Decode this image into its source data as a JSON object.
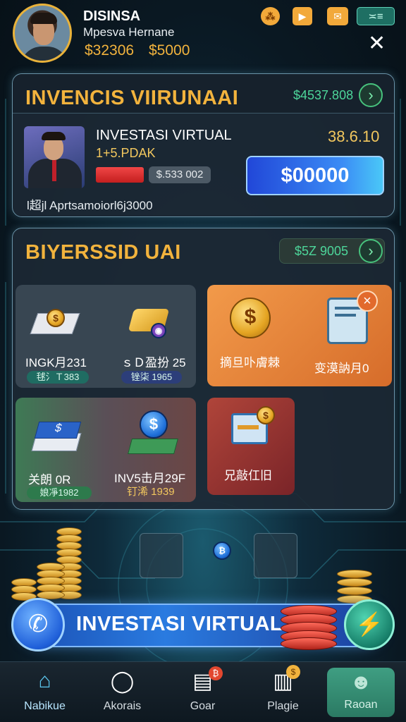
{
  "header": {
    "name": "DISINSA",
    "subtitle": "Mpesva Hernane",
    "balance_1": "$32306",
    "balance_2": "$5000",
    "top_icons": [
      "coin-icon",
      "play-icon",
      "gift-icon",
      "menu-icon"
    ],
    "menu_label": "≍≡",
    "close_label": "✕"
  },
  "panel_top": {
    "title": "INVENCIS VIIRUNAAI",
    "amount": "$4537.808",
    "item_title": "INVESTASI VIRTUAL",
    "item_sub": "1+5.PDAK",
    "item_pill": "$.533 002",
    "item_right": "38.6.10",
    "button_label": "$00000",
    "footer": "l超jl Aprtsamoiorl6j3000"
  },
  "panel_bottom": {
    "title": "BIYERSSID UAI",
    "amount": "$5Z 9005",
    "tiles": [
      {
        "label": "INGK月231",
        "pill": "毬氵Ｔ383"
      },
      {
        "label": "ｓＤ盈扮 25",
        "pill": "锉柒 1965"
      },
      {
        "label": "摘旦卟膚棘"
      },
      {
        "label": "变漠訥月0"
      },
      {
        "label": "关朗 0R",
        "pill": "娘凈1982"
      },
      {
        "label": "INV5击月29F",
        "pill": "钉浠 1939"
      },
      {
        "label": "兄敲仜旧"
      }
    ]
  },
  "banner": {
    "label": "INVESTASI VIRTUAL"
  },
  "nav": [
    {
      "label": "Nabikue",
      "icon": "home-icon"
    },
    {
      "label": "Akorais",
      "icon": "chat-icon"
    },
    {
      "label": "Goar",
      "icon": "wallet-icon",
      "badge": "₿"
    },
    {
      "label": "Plagie",
      "icon": "document-icon",
      "badge": "$"
    },
    {
      "label": "Raoan",
      "icon": "users-icon"
    }
  ],
  "colors": {
    "gold": "#f2b33d",
    "green": "#4dd69a",
    "blue": "#2a7be0",
    "orange": "#e07a34"
  }
}
